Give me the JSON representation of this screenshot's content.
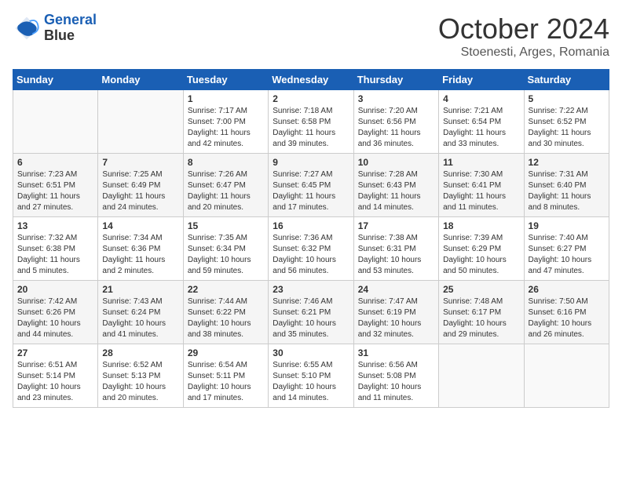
{
  "header": {
    "logo_line1": "General",
    "logo_line2": "Blue",
    "month": "October 2024",
    "location": "Stoenesti, Arges, Romania"
  },
  "weekdays": [
    "Sunday",
    "Monday",
    "Tuesday",
    "Wednesday",
    "Thursday",
    "Friday",
    "Saturday"
  ],
  "weeks": [
    [
      {
        "day": "",
        "info": ""
      },
      {
        "day": "",
        "info": ""
      },
      {
        "day": "1",
        "info": "Sunrise: 7:17 AM\nSunset: 7:00 PM\nDaylight: 11 hours and 42 minutes."
      },
      {
        "day": "2",
        "info": "Sunrise: 7:18 AM\nSunset: 6:58 PM\nDaylight: 11 hours and 39 minutes."
      },
      {
        "day": "3",
        "info": "Sunrise: 7:20 AM\nSunset: 6:56 PM\nDaylight: 11 hours and 36 minutes."
      },
      {
        "day": "4",
        "info": "Sunrise: 7:21 AM\nSunset: 6:54 PM\nDaylight: 11 hours and 33 minutes."
      },
      {
        "day": "5",
        "info": "Sunrise: 7:22 AM\nSunset: 6:52 PM\nDaylight: 11 hours and 30 minutes."
      }
    ],
    [
      {
        "day": "6",
        "info": "Sunrise: 7:23 AM\nSunset: 6:51 PM\nDaylight: 11 hours and 27 minutes."
      },
      {
        "day": "7",
        "info": "Sunrise: 7:25 AM\nSunset: 6:49 PM\nDaylight: 11 hours and 24 minutes."
      },
      {
        "day": "8",
        "info": "Sunrise: 7:26 AM\nSunset: 6:47 PM\nDaylight: 11 hours and 20 minutes."
      },
      {
        "day": "9",
        "info": "Sunrise: 7:27 AM\nSunset: 6:45 PM\nDaylight: 11 hours and 17 minutes."
      },
      {
        "day": "10",
        "info": "Sunrise: 7:28 AM\nSunset: 6:43 PM\nDaylight: 11 hours and 14 minutes."
      },
      {
        "day": "11",
        "info": "Sunrise: 7:30 AM\nSunset: 6:41 PM\nDaylight: 11 hours and 11 minutes."
      },
      {
        "day": "12",
        "info": "Sunrise: 7:31 AM\nSunset: 6:40 PM\nDaylight: 11 hours and 8 minutes."
      }
    ],
    [
      {
        "day": "13",
        "info": "Sunrise: 7:32 AM\nSunset: 6:38 PM\nDaylight: 11 hours and 5 minutes."
      },
      {
        "day": "14",
        "info": "Sunrise: 7:34 AM\nSunset: 6:36 PM\nDaylight: 11 hours and 2 minutes."
      },
      {
        "day": "15",
        "info": "Sunrise: 7:35 AM\nSunset: 6:34 PM\nDaylight: 10 hours and 59 minutes."
      },
      {
        "day": "16",
        "info": "Sunrise: 7:36 AM\nSunset: 6:32 PM\nDaylight: 10 hours and 56 minutes."
      },
      {
        "day": "17",
        "info": "Sunrise: 7:38 AM\nSunset: 6:31 PM\nDaylight: 10 hours and 53 minutes."
      },
      {
        "day": "18",
        "info": "Sunrise: 7:39 AM\nSunset: 6:29 PM\nDaylight: 10 hours and 50 minutes."
      },
      {
        "day": "19",
        "info": "Sunrise: 7:40 AM\nSunset: 6:27 PM\nDaylight: 10 hours and 47 minutes."
      }
    ],
    [
      {
        "day": "20",
        "info": "Sunrise: 7:42 AM\nSunset: 6:26 PM\nDaylight: 10 hours and 44 minutes."
      },
      {
        "day": "21",
        "info": "Sunrise: 7:43 AM\nSunset: 6:24 PM\nDaylight: 10 hours and 41 minutes."
      },
      {
        "day": "22",
        "info": "Sunrise: 7:44 AM\nSunset: 6:22 PM\nDaylight: 10 hours and 38 minutes."
      },
      {
        "day": "23",
        "info": "Sunrise: 7:46 AM\nSunset: 6:21 PM\nDaylight: 10 hours and 35 minutes."
      },
      {
        "day": "24",
        "info": "Sunrise: 7:47 AM\nSunset: 6:19 PM\nDaylight: 10 hours and 32 minutes."
      },
      {
        "day": "25",
        "info": "Sunrise: 7:48 AM\nSunset: 6:17 PM\nDaylight: 10 hours and 29 minutes."
      },
      {
        "day": "26",
        "info": "Sunrise: 7:50 AM\nSunset: 6:16 PM\nDaylight: 10 hours and 26 minutes."
      }
    ],
    [
      {
        "day": "27",
        "info": "Sunrise: 6:51 AM\nSunset: 5:14 PM\nDaylight: 10 hours and 23 minutes."
      },
      {
        "day": "28",
        "info": "Sunrise: 6:52 AM\nSunset: 5:13 PM\nDaylight: 10 hours and 20 minutes."
      },
      {
        "day": "29",
        "info": "Sunrise: 6:54 AM\nSunset: 5:11 PM\nDaylight: 10 hours and 17 minutes."
      },
      {
        "day": "30",
        "info": "Sunrise: 6:55 AM\nSunset: 5:10 PM\nDaylight: 10 hours and 14 minutes."
      },
      {
        "day": "31",
        "info": "Sunrise: 6:56 AM\nSunset: 5:08 PM\nDaylight: 10 hours and 11 minutes."
      },
      {
        "day": "",
        "info": ""
      },
      {
        "day": "",
        "info": ""
      }
    ]
  ]
}
